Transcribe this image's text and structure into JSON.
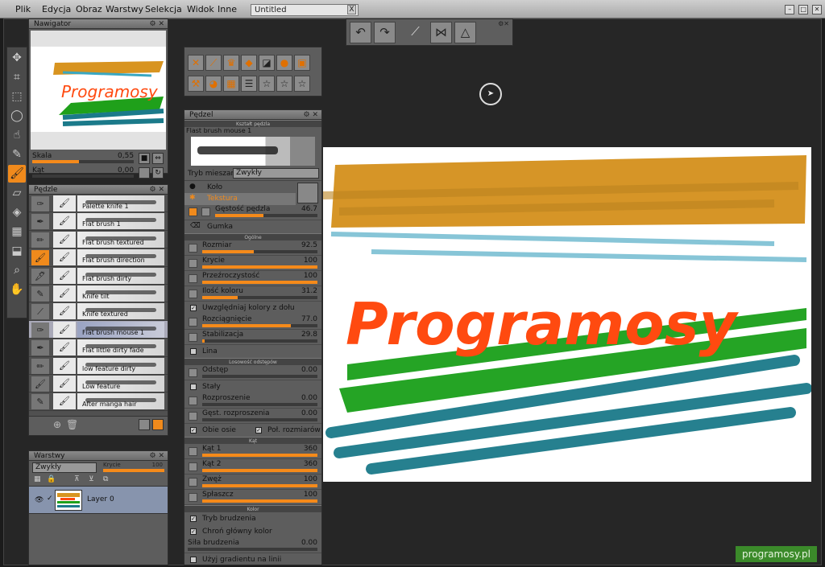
{
  "menu": [
    "Plik",
    "Edycja",
    "Obraz",
    "Warstwy",
    "Selekcja",
    "Widok",
    "Inne"
  ],
  "document_tab": {
    "title": "Untitled",
    "close": "X"
  },
  "navigator": {
    "title": "Nawigator",
    "scale_label": "Skala",
    "scale_value": "0,55",
    "scale_fraction": 0.46,
    "angle_label": "Kąt",
    "angle_value": "0,00",
    "angle_fraction": 0.0
  },
  "tools": [
    "move-tool",
    "crop-tool",
    "rect-select-tool",
    "lasso-tool",
    "smudge-tool",
    "eyedropper-tool",
    "brush-tool",
    "eraser-tool",
    "fill-tool",
    "gradient-tool",
    "stamp-tool",
    "zoom-tool",
    "hand-tool"
  ],
  "toolbar_top": [
    "undo-icon",
    "redo-icon",
    "brush-icon",
    "symmetry-icon",
    "stroke-icon"
  ],
  "icon_grid": [
    "tools-icon",
    "brush-settings-icon",
    "crown-icon",
    "layers-icon",
    "gradient-icon",
    "color-icon",
    "image-icon",
    "hammer-icon",
    "palette-icon",
    "grid-icon",
    "notes-icon",
    "star-icon",
    "star-icon",
    "star-icon"
  ],
  "brushes_panel": {
    "title": "Pędzle",
    "items": [
      {
        "name": "Palette knife 1"
      },
      {
        "name": "Flat brush 1"
      },
      {
        "name": "Flat brush textured"
      },
      {
        "name": "Flat brush direction"
      },
      {
        "name": "Flat brush dirty"
      },
      {
        "name": "Knife tilt"
      },
      {
        "name": "Knife textured"
      },
      {
        "name": "Flat brush mouse 1",
        "selected": true
      },
      {
        "name": "Flat little dirty fade"
      },
      {
        "name": "low feature dirty"
      },
      {
        "name": "Low feature"
      },
      {
        "name": "After manga hair"
      }
    ]
  },
  "layers_panel": {
    "title": "Warstwy",
    "blend_mode": "Zwykły",
    "opacity_label": "Krycie",
    "opacity_value": "100",
    "layer_name": "Layer 0"
  },
  "brush_panel": {
    "title": "Pędzel",
    "shape_header": "Kształt pędzla",
    "brush_name": "Flast brush mouse 1",
    "blend_label": "Tryb mieszania",
    "blend_value": "Zwykły",
    "tip_circle": "Koło",
    "tip_texture": "Tekstura",
    "density_label": "Gęstość pędzla",
    "density_value": "46.7",
    "density_fraction": 0.47,
    "eraser_label": "Gumka",
    "general_header": "Ogólne",
    "general": [
      {
        "label": "Rozmiar",
        "value": "92.5",
        "fraction": 0.45
      },
      {
        "label": "Krycie",
        "value": "100",
        "fraction": 1.0
      },
      {
        "label": "Przeźroczystość",
        "value": "100",
        "fraction": 1.0
      },
      {
        "label": "Ilość koloru",
        "value": "31.2",
        "fraction": 0.31
      }
    ],
    "include_colors": "Uwzględniaj kolory z dołu",
    "general2": [
      {
        "label": "Rozciągnięcie",
        "value": "77.0",
        "fraction": 0.77
      },
      {
        "label": "Stabilizacja",
        "value": "29.8",
        "fraction": 0.02
      }
    ],
    "line_label": "Lina",
    "spacing_header": "Losowość odstępów",
    "spacing": [
      {
        "label": "Odstęp",
        "value": "0.00",
        "fraction": 0.0
      }
    ],
    "constant_label": "Stały",
    "scatter": [
      {
        "label": "Rozproszenie",
        "value": "0.00",
        "fraction": 0.0
      },
      {
        "label": "Gęst. rozproszenia",
        "value": "0.00",
        "fraction": 0.0
      }
    ],
    "both_axes": "Obie osie",
    "half_size": "Poł. rozmiarów",
    "angle_header": "Kąt",
    "angle": [
      {
        "label": "Kąt 1",
        "value": "360",
        "fraction": 1.0
      },
      {
        "label": "Kąt 2",
        "value": "360",
        "fraction": 1.0
      },
      {
        "label": "Zwęż",
        "value": "100",
        "fraction": 1.0
      },
      {
        "label": "Spłaszcz",
        "value": "100",
        "fraction": 1.0
      }
    ],
    "color_header": "Kolor",
    "dirty_mode": "Tryb brudzenia",
    "protect_color": "Chroń główny kolor",
    "dirt_strength_label": "Siła brudzenia",
    "dirt_strength_value": "0.00",
    "use_gradient": "Użyj gradientu na linii"
  },
  "canvas": {
    "text": "Programosy"
  },
  "watermark": "programosy.pl",
  "colors": {
    "accent": "#f58a1a",
    "panel": "#5d5d5d",
    "workspace": "#262626"
  }
}
